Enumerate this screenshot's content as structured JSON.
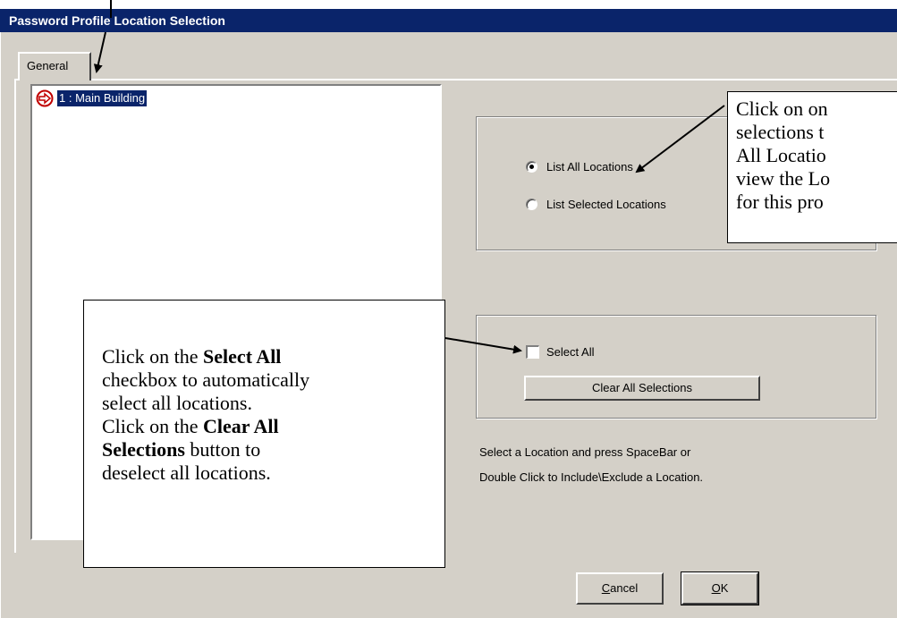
{
  "window": {
    "title": "Password Profile Location Selection"
  },
  "tabs": [
    {
      "label": "General"
    }
  ],
  "location_list": {
    "items": [
      {
        "label": "1 : Main Building",
        "icon": "location-arrow-icon",
        "selected": true
      }
    ]
  },
  "view_options": {
    "list_all": {
      "label": "List All Locations",
      "checked": true
    },
    "list_selected": {
      "label": "List Selected Locations",
      "checked": false
    }
  },
  "selection": {
    "select_all_label": "Select All",
    "select_all_checked": false,
    "clear_button": "Clear All Selections"
  },
  "hint": {
    "line1": "Select a Location and press SpaceBar or",
    "line2": "Double Click to Include\\Exclude a Location."
  },
  "buttons": {
    "cancel_pre": "",
    "cancel_accel": "C",
    "cancel_post": "ancel",
    "ok_pre": "",
    "ok_accel": "O",
    "ok_post": "K"
  },
  "callout_view": {
    "line1": "Click on on",
    "line2": "selections t",
    "line3": "All Locatio",
    "line4": "view the Lo",
    "line5": "for this pro"
  },
  "callout_select": {
    "l1_pre": "Click on the ",
    "l1_bold": "Select All",
    "l2": "checkbox to automatically",
    "l3": "select all locations.",
    "l4_pre": "Click on the ",
    "l4_bold": "Clear All",
    "l5_bold": "Selections",
    "l5_post": " button to",
    "l6": "deselect all locations."
  },
  "colors": {
    "titlebar": "#0a246a",
    "dialog_face": "#d4d0c8",
    "selection": "#0a246a"
  }
}
